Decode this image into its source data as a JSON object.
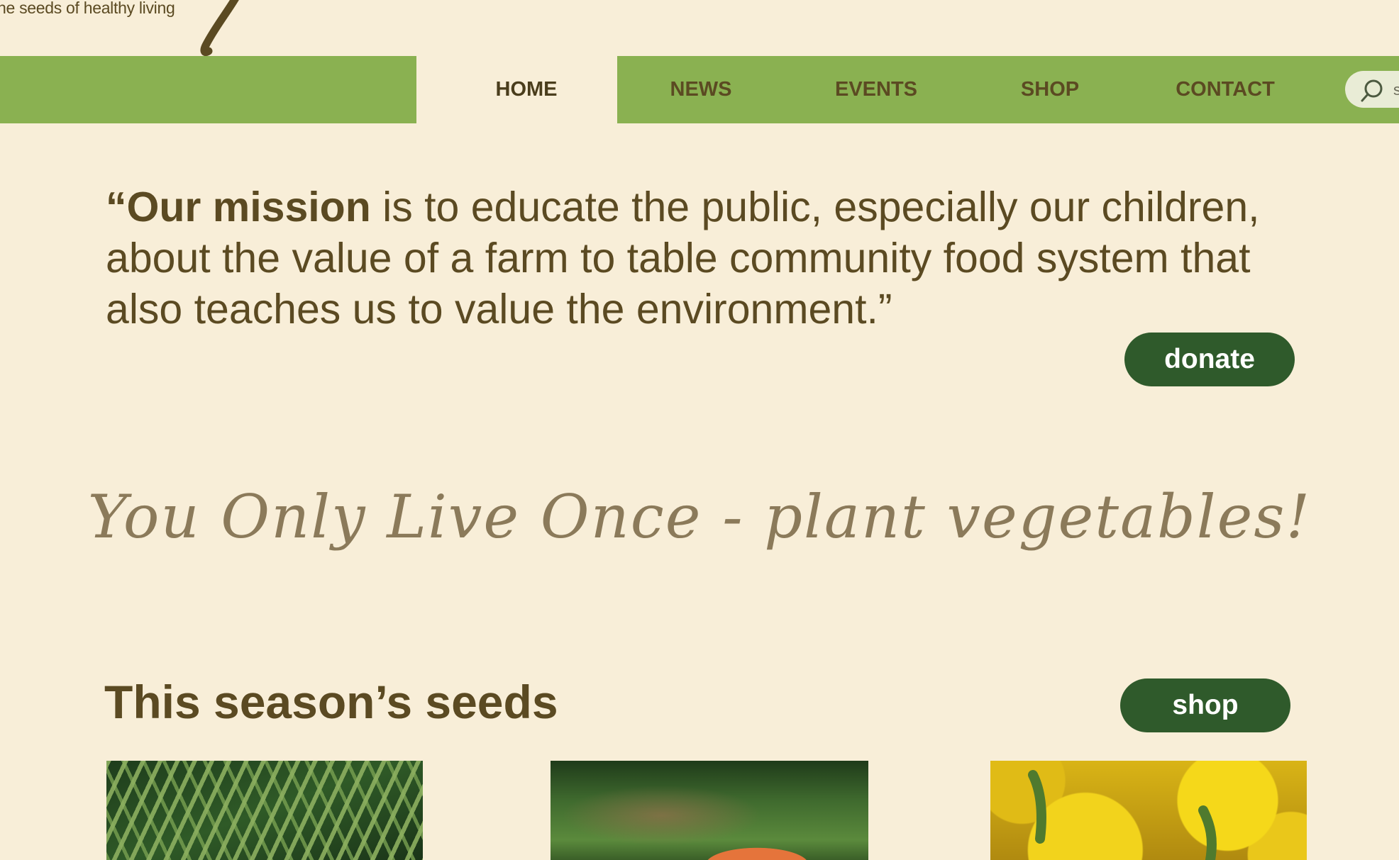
{
  "header": {
    "logo_tagline": "he seeds of healthy living"
  },
  "nav": {
    "items": [
      {
        "label": "HOME",
        "active": true
      },
      {
        "label": "NEWS",
        "active": false
      },
      {
        "label": "EVENTS",
        "active": false
      },
      {
        "label": "SHOP",
        "active": false
      },
      {
        "label": "CONTACT",
        "active": false
      }
    ],
    "search_placeholder": "s",
    "bar_color": "#8ab151"
  },
  "mission": {
    "lead": "“Our mission",
    "body": " is to educate the public, especially our children, about the value of a farm to table community food system that also teaches us to value the environment.”"
  },
  "donate_label": "donate",
  "tagline": "You Only Live Once - plant vegetables!",
  "season": {
    "title": "This season’s seeds",
    "shop_label": "shop"
  },
  "colors": {
    "background": "#f8eed8",
    "text": "#5b4a22",
    "button": "#2f5a2b"
  }
}
